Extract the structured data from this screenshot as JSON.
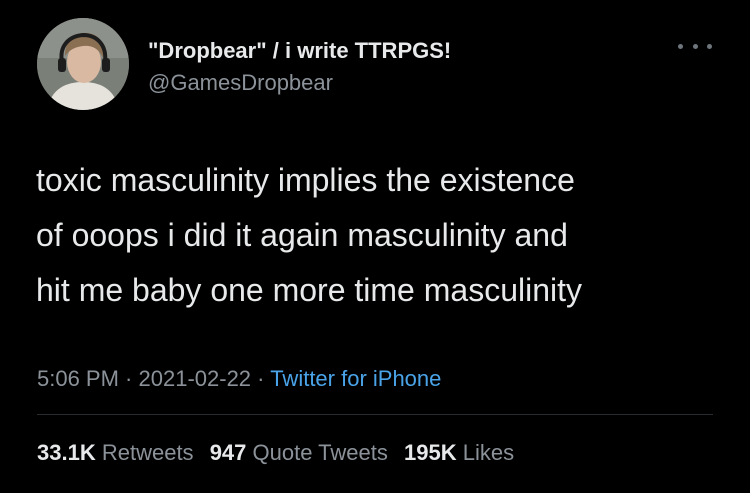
{
  "author": {
    "display_name": "\"Dropbear\" / i write TTRPGS!",
    "handle": "@GamesDropbear",
    "avatar_icon": "profile-photo"
  },
  "more_icon": "more-options-icon",
  "tweet": {
    "lines": [
      "toxic masculinity implies the existence",
      "of ooops i did it again masculinity and",
      "hit me baby one more time masculinity"
    ]
  },
  "meta": {
    "time": "5:06 PM",
    "separator": " · ",
    "date": "2021-02-22",
    "source": "Twitter for iPhone"
  },
  "stats": {
    "retweets_count": "33.1K",
    "retweets_label": "Retweets",
    "quotes_count": "947",
    "quotes_label": "Quote Tweets",
    "likes_count": "195K",
    "likes_label": "Likes"
  },
  "colors": {
    "background": "#000000",
    "text_primary": "#e7e9ea",
    "text_secondary": "#8b9299",
    "link": "#4aa3e8"
  }
}
